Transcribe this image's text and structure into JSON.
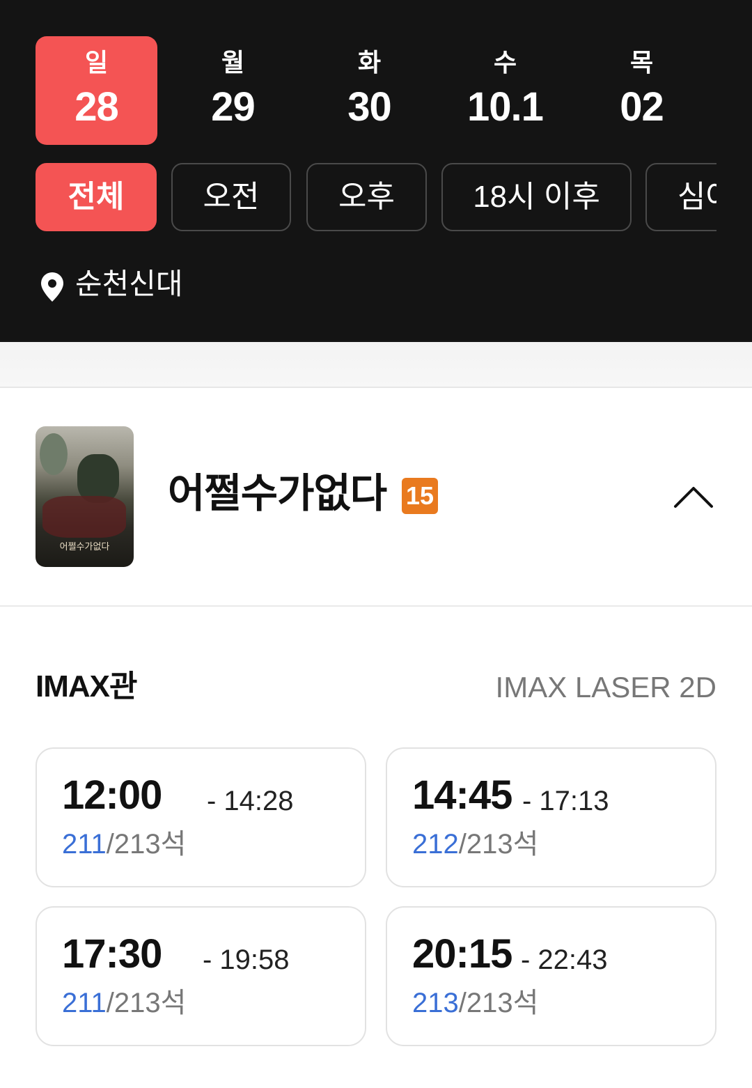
{
  "dates": [
    {
      "dow": "일",
      "day": "28",
      "active": true
    },
    {
      "dow": "월",
      "day": "29",
      "active": false
    },
    {
      "dow": "화",
      "day": "30",
      "active": false
    },
    {
      "dow": "수",
      "day": "10.1",
      "active": false
    },
    {
      "dow": "목",
      "day": "02",
      "active": false
    }
  ],
  "filters": [
    "전체",
    "오전",
    "오후",
    "18시 이후",
    "심야"
  ],
  "active_filter": "전체",
  "location": {
    "name": "순천신대",
    "icon": "location-pin-icon"
  },
  "movie": {
    "title": "어쩔수가없다",
    "rating": "15",
    "poster_title": "어쩔수가없다",
    "collapse_icon": "chevron-up-icon"
  },
  "screen": {
    "name": "IMAX관",
    "format": "IMAX LASER 2D"
  },
  "showtimes": [
    {
      "start": "12:00",
      "end": "- 14:28",
      "available": "211",
      "total": "/213석"
    },
    {
      "start": "14:45",
      "end": "- 17:13",
      "available": "212",
      "total": "/213석"
    },
    {
      "start": "17:30",
      "end": "- 19:58",
      "available": "211",
      "total": "/213석"
    },
    {
      "start": "20:15",
      "end": "- 22:43",
      "available": "213",
      "total": "/213석"
    }
  ],
  "colors": {
    "accent": "#f45454",
    "header_bg": "#141414",
    "seat_available": "#3a6fd6",
    "rating_15": "#e97a1f"
  }
}
